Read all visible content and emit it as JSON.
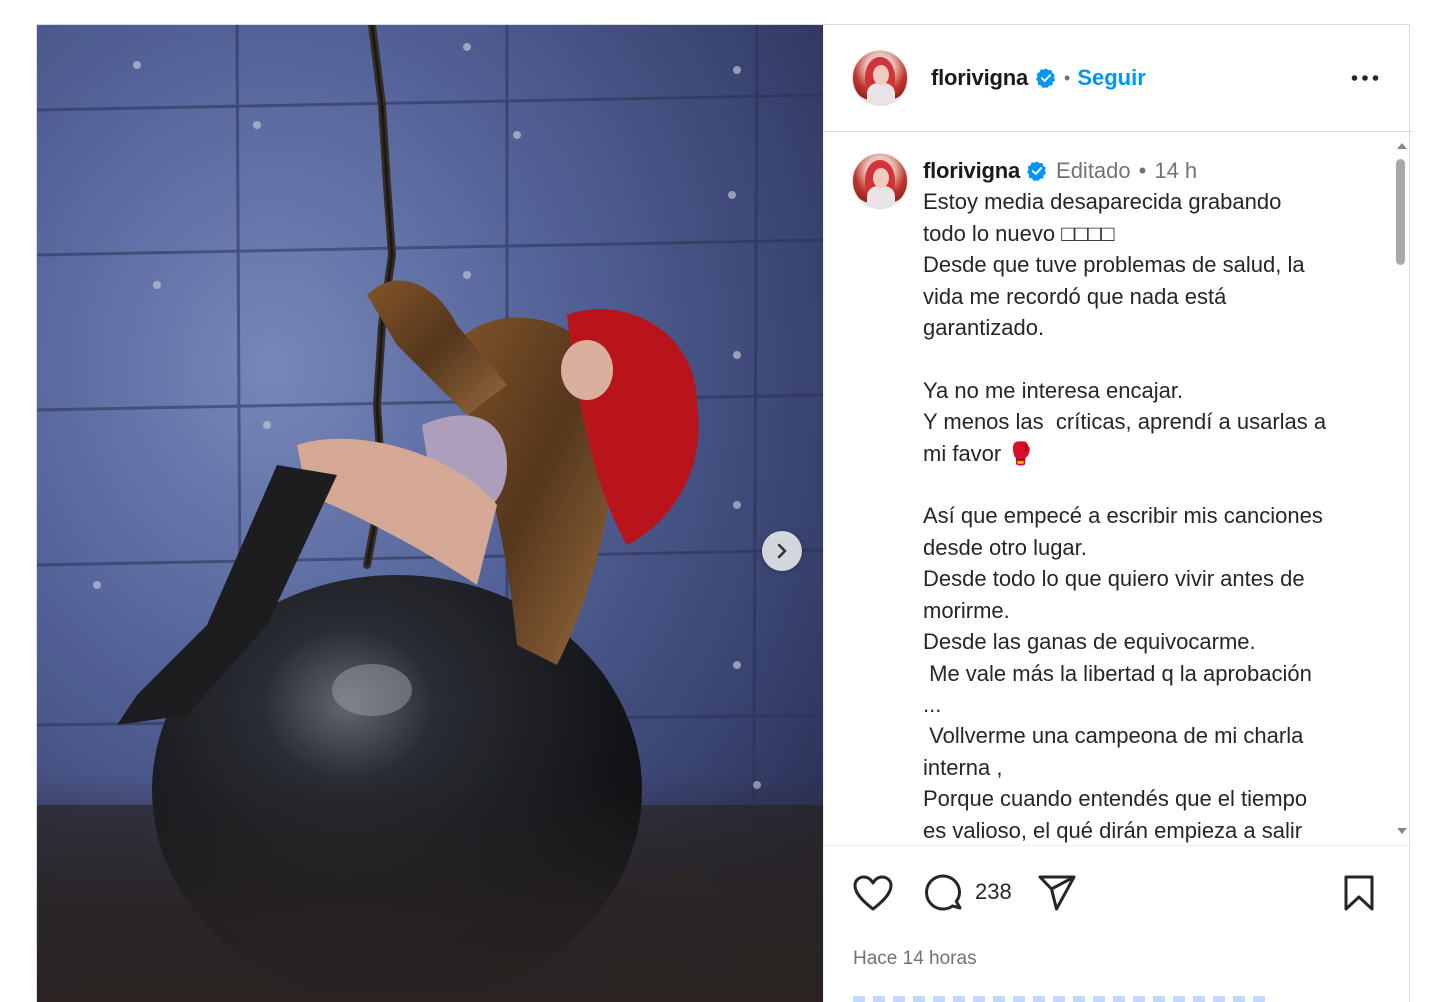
{
  "post": {
    "username": "florivigna",
    "follow_label": "Seguir",
    "separator": "•",
    "edited_label": "Editado",
    "age_short": "14 h",
    "caption_lines": [
      "Estoy media desaparecida grabando",
      "todo lo nuevo □□□□",
      "Desde que tuve problemas de salud, la",
      "vida me recordó que nada está",
      "garantizado.",
      " ",
      "Ya no me interesa encajar.",
      "Y menos las  críticas, aprendí a usarlas a",
      "mi favor 🥊",
      " ",
      "Así que empecé a escribir mis canciones",
      "desde otro lugar.",
      "Desde todo lo que quiero vivir antes de",
      "morirme.",
      "Desde las ganas de equivocarme.",
      " Me vale más la libertad q la aprobación",
      "...",
      " Vollverme una campeona de mi charla",
      "interna ,",
      "Porque cuando entendés que el tiempo",
      "es valioso, el qué dirán empieza a salir"
    ],
    "comment_count": "238",
    "timestamp": "Hace 14 horas"
  },
  "icons": {
    "verified": "verified-badge-icon",
    "more": "more-options-icon",
    "next": "chevron-right-icon",
    "like": "heart-icon",
    "comment": "comment-icon",
    "share": "send-icon",
    "save": "bookmark-icon"
  },
  "colors": {
    "accent": "#0095f6",
    "secondary_text": "#737373",
    "border": "#dbdbdb"
  }
}
